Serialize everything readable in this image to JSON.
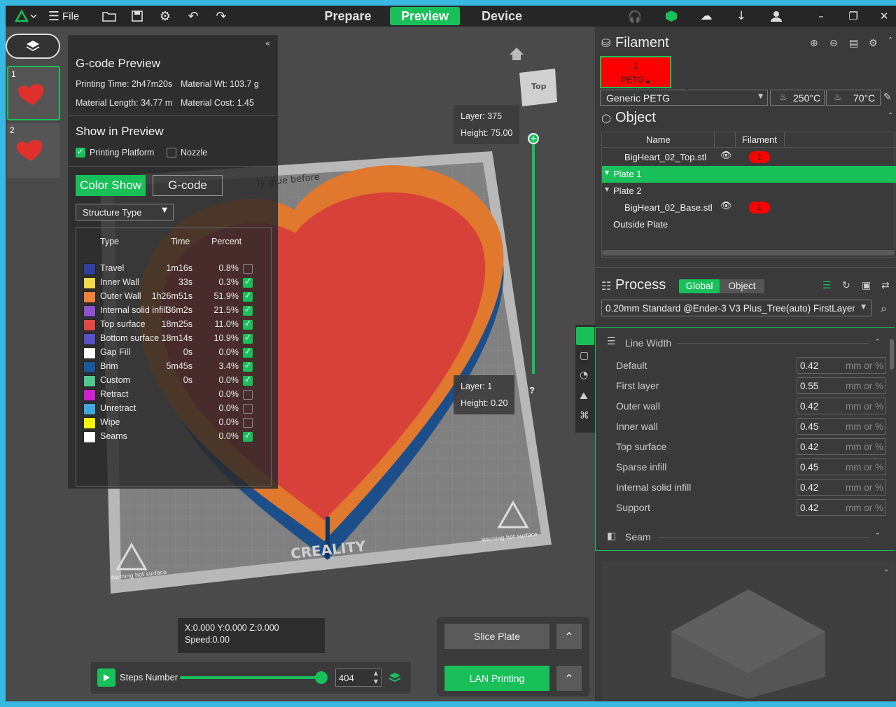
{
  "menu": {
    "file_label": "File"
  },
  "tabs": [
    {
      "label": "Prepare",
      "active": false
    },
    {
      "label": "Preview",
      "active": true
    },
    {
      "label": "Device",
      "active": false
    }
  ],
  "plates": [
    {
      "num": "1"
    },
    {
      "num": "2"
    }
  ],
  "gcode": {
    "title": "G-code Preview",
    "printing_time": "Printing Time: 2h47m20s",
    "material_wt": "Material Wt: 103.7 g",
    "material_length": "Material Length: 34.77 m",
    "material_cost": "Material Cost: 1.45",
    "show_title": "Show in Preview",
    "printing_platform": "Printing Platform",
    "nozzle": "Nozzle",
    "color_show": "Color Show",
    "gcode_btn": "G-code",
    "structure_type": "Structure Type",
    "col_type": "Type",
    "col_time": "Time",
    "col_percent": "Percent",
    "rows": [
      {
        "type": "Travel",
        "time": "1m16s",
        "pct": "0.8%",
        "color": "#2f3fa0",
        "checked": false
      },
      {
        "type": "Inner Wall",
        "time": "33s",
        "pct": "0.3%",
        "color": "#f2d94a",
        "checked": true
      },
      {
        "type": "Outer Wall",
        "time": "1h26m51s",
        "pct": "51.9%",
        "color": "#f0803a",
        "checked": true
      },
      {
        "type": "Internal solid infill",
        "time": "36m2s",
        "pct": "21.5%",
        "color": "#9050d0",
        "checked": true
      },
      {
        "type": "Top surface",
        "time": "18m25s",
        "pct": "11.0%",
        "color": "#e04848",
        "checked": true
      },
      {
        "type": "Bottom surface",
        "time": "18m14s",
        "pct": "10.9%",
        "color": "#5a50c8",
        "checked": true
      },
      {
        "type": "Gap Fill",
        "time": "0s",
        "pct": "0.0%",
        "color": "#ffffff",
        "checked": true
      },
      {
        "type": "Brim",
        "time": "5m45s",
        "pct": "3.4%",
        "color": "#1a5a9a",
        "checked": true
      },
      {
        "type": "Custom",
        "time": "0s",
        "pct": "0.0%",
        "color": "#50c890",
        "checked": true
      },
      {
        "type": "Retract",
        "time": "",
        "pct": "0.0%",
        "color": "#d020d0",
        "checked": false
      },
      {
        "type": "Unretract",
        "time": "",
        "pct": "0.0%",
        "color": "#40a8e0",
        "checked": false
      },
      {
        "type": "Wipe",
        "time": "",
        "pct": "0.0%",
        "color": "#f8f800",
        "checked": false
      },
      {
        "type": "Seams",
        "time": "",
        "pct": "0.0%",
        "color": "#ffffff",
        "checked": true
      }
    ]
  },
  "viewport": {
    "layer_top": "Layer: 375",
    "height_top": "Height: 75.00",
    "layer_bottom": "Layer: 1",
    "height_bottom": "Height: 0.20",
    "cube_label": "Top",
    "bed_text": "ly glue before",
    "brand": "CREALITY",
    "warning_left": "Warning hot surface",
    "warning_right": "Warning hot surface",
    "help": "?",
    "coords": "X:0.000  Y:0.000  Z:0.000",
    "speed": "Speed:0.00",
    "steps_label": "Steps Number",
    "steps_value": "404",
    "steps_fraction": 0.96,
    "slice_plate": "Slice Plate",
    "lan_printing": "LAN Printing"
  },
  "filament": {
    "title": "Filament",
    "slot_num": "1",
    "slot_type": "PETG",
    "slot_color": "#ff0000",
    "preset": "Generic PETG",
    "nozzle_temp": "250°C",
    "bed_temp": "70°C"
  },
  "object": {
    "title": "Object",
    "col_name": "Name",
    "col_filament": "Filament",
    "rows": [
      {
        "name": "BigHeart_02_Top.stl",
        "filament": "1"
      },
      {
        "name": "Plate 1"
      },
      {
        "name": "Plate 2"
      },
      {
        "name": "BigHeart_02_Base.stl",
        "filament": "1"
      },
      {
        "name": "Outside Plate"
      }
    ]
  },
  "process": {
    "title": "Process",
    "tab_global": "Global",
    "tab_object": "Object",
    "preset": "0.20mm Standard @Ender-3 V3 Plus_Tree(auto) FirstLayer...",
    "line_width_title": "Line Width",
    "seam_title": "Seam",
    "unit": "mm or %",
    "fields": [
      {
        "label": "Default",
        "value": "0.42"
      },
      {
        "label": "First layer",
        "value": "0.55"
      },
      {
        "label": "Outer wall",
        "value": "0.42"
      },
      {
        "label": "Inner wall",
        "value": "0.45"
      },
      {
        "label": "Top surface",
        "value": "0.42"
      },
      {
        "label": "Sparse infill",
        "value": "0.45"
      },
      {
        "label": "Internal solid infill",
        "value": "0.42"
      },
      {
        "label": "Support",
        "value": "0.42"
      }
    ]
  }
}
